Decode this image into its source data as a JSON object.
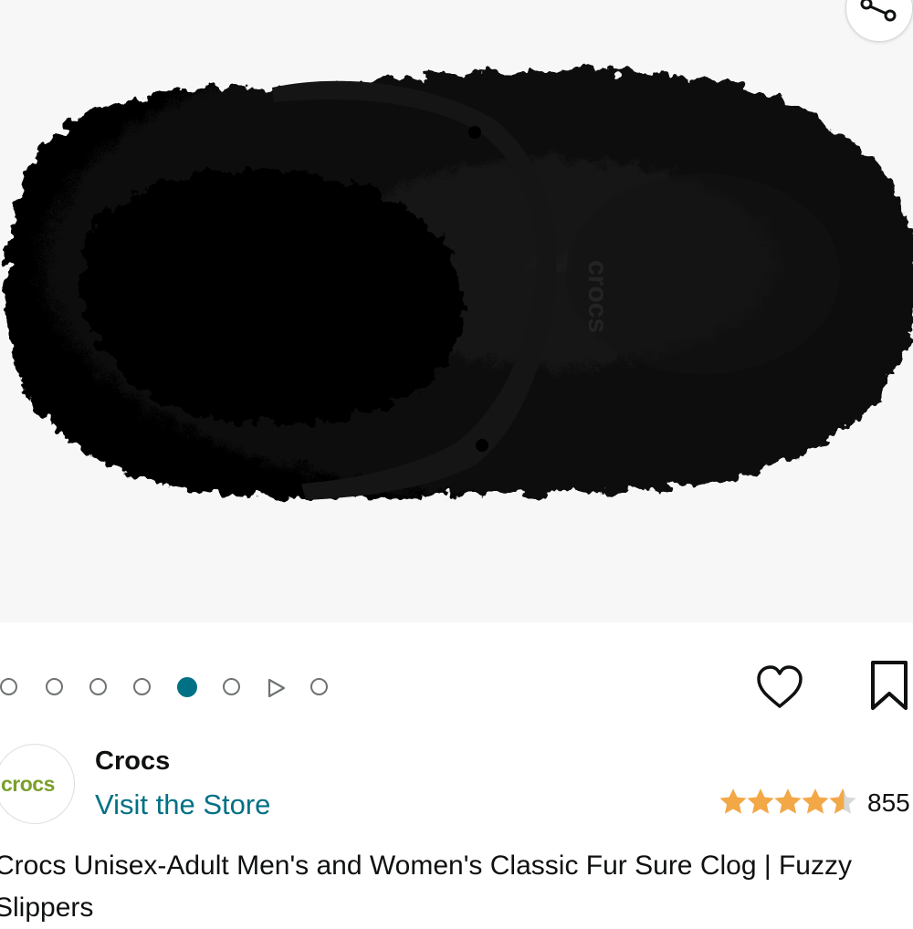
{
  "gallery": {
    "image_alt": "Black fuzzy clog, top view",
    "strap_text": "crocs",
    "dots_total": 8,
    "active_index": 4,
    "video_index": 6
  },
  "icons": {
    "share": "share-icon",
    "heart": "heart-icon",
    "bookmark": "bookmark-icon",
    "play": "play-icon"
  },
  "brand": {
    "logo_text": "crocs",
    "name": "Crocs",
    "store_link": "Visit the Store"
  },
  "rating": {
    "stars": 4.5,
    "max": 5,
    "count": "855"
  },
  "product": {
    "title": "Crocs Unisex-Adult Men's and Women's Classic Fur Sure Clog | Fuzzy Slippers"
  },
  "colors": {
    "accent": "#007185",
    "star": "#f3a847",
    "logo_green": "#7aa02c",
    "text": "#0f1111"
  }
}
